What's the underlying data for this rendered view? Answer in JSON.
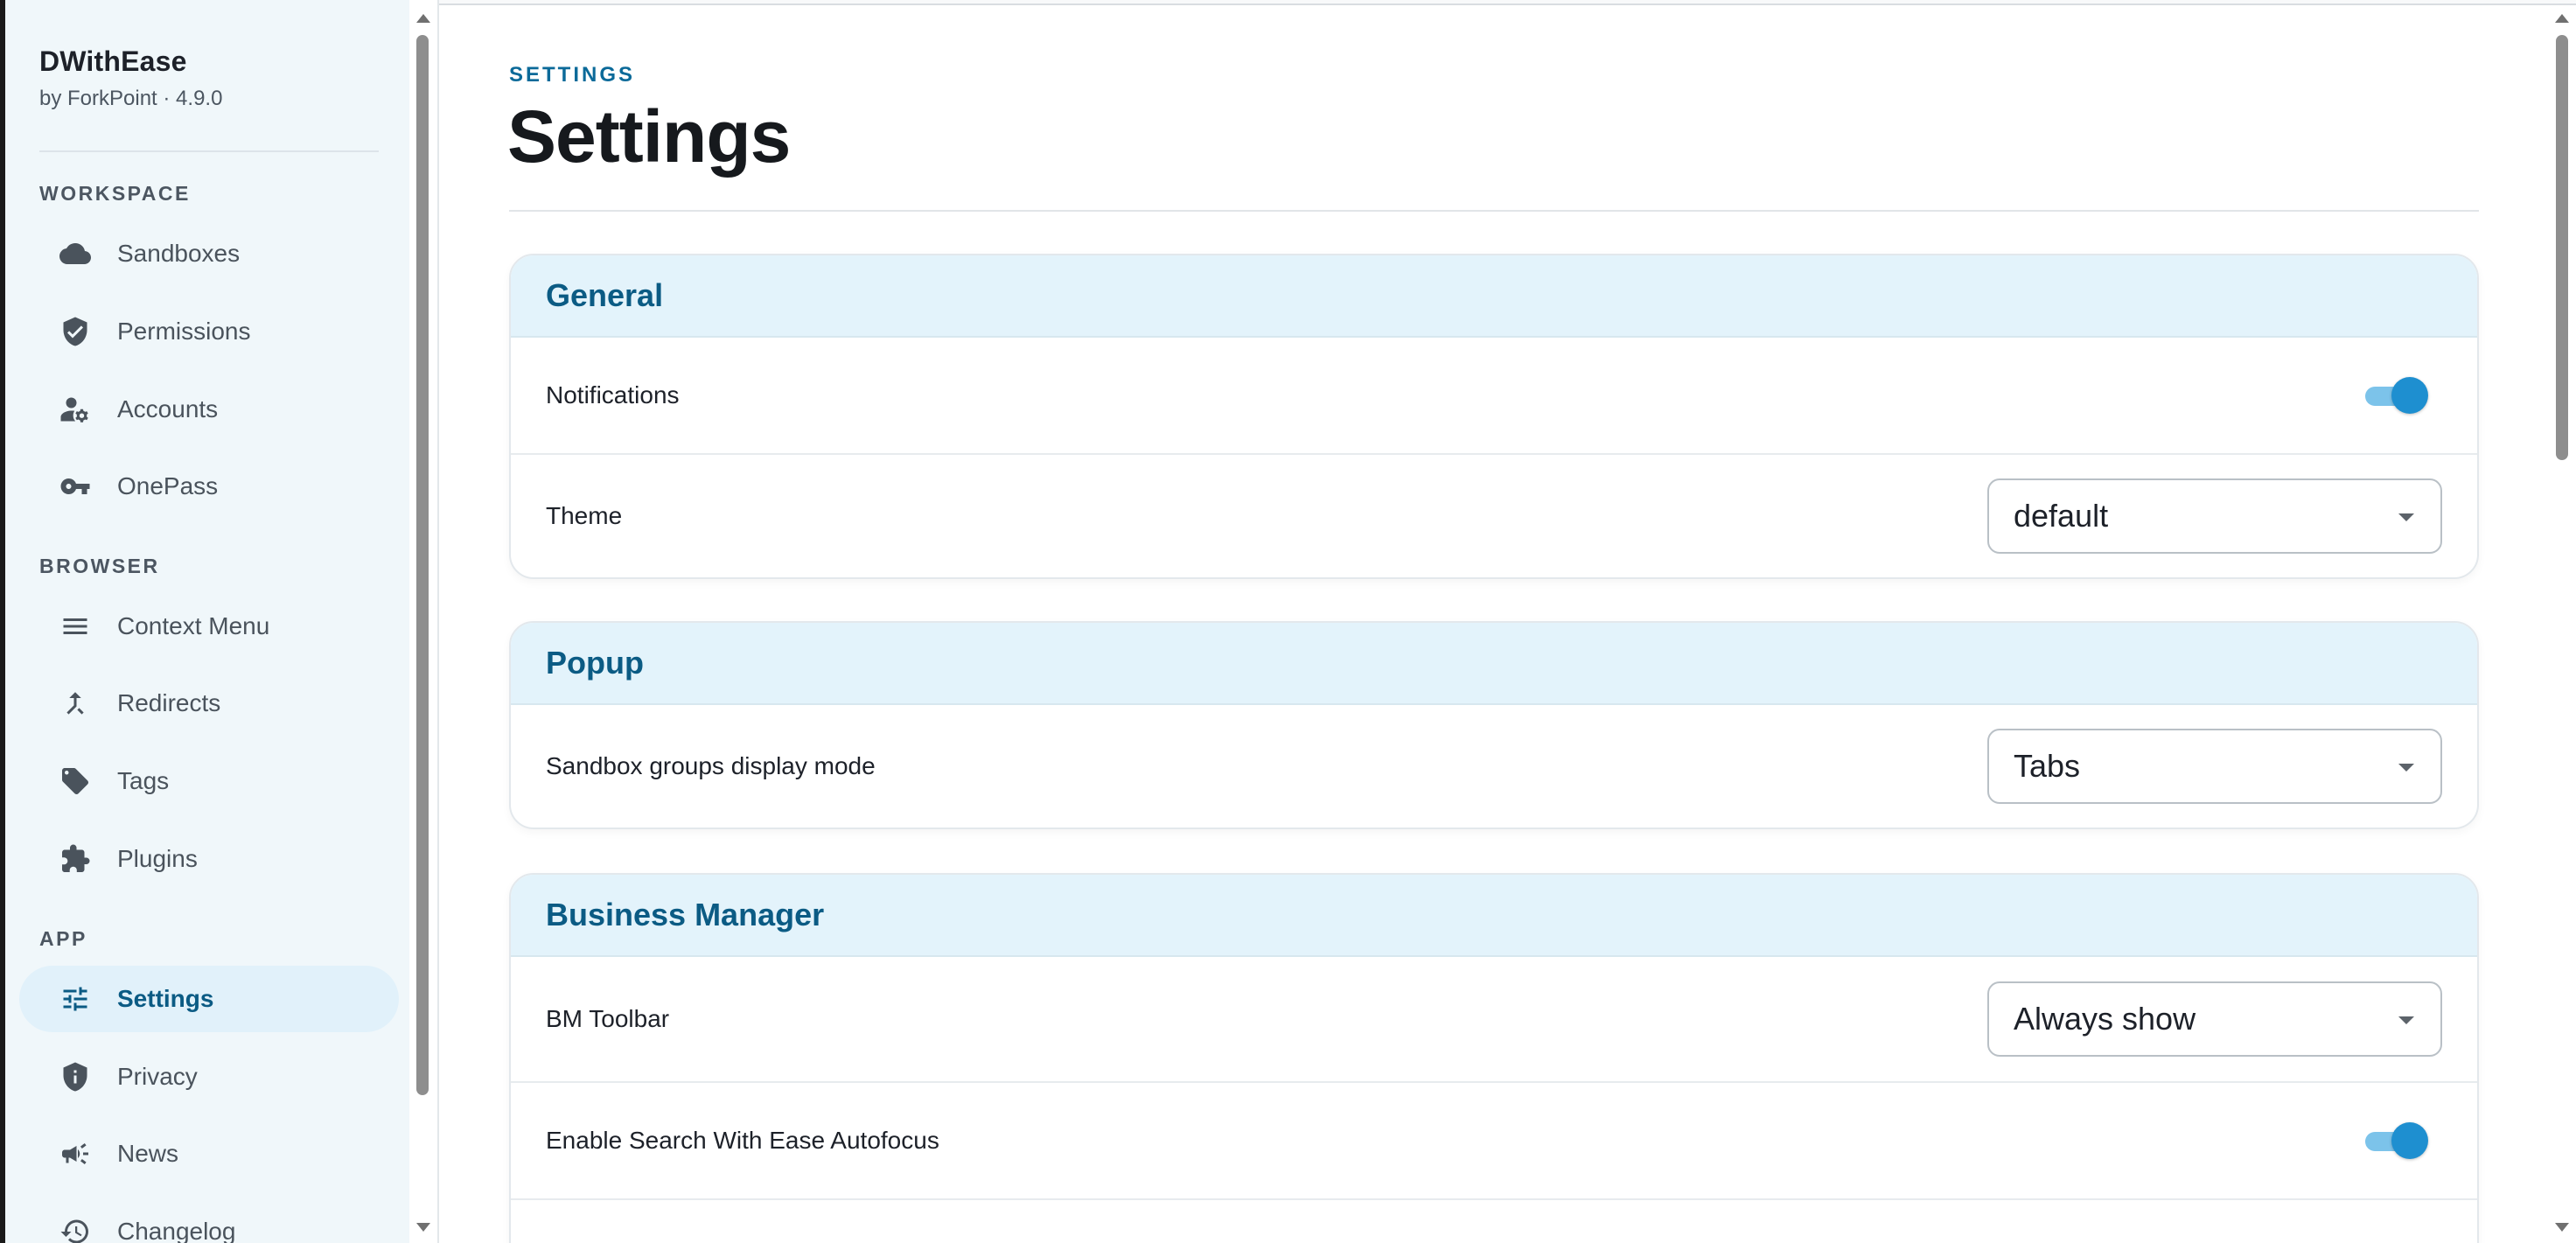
{
  "brand": {
    "name": "DWithEase",
    "subtitle": "by ForkPoint · 4.9.0"
  },
  "sidebar": {
    "sections": [
      {
        "title": "WORKSPACE",
        "items": [
          {
            "label": "Sandboxes",
            "icon": "cloud-icon"
          },
          {
            "label": "Permissions",
            "icon": "shield-check-icon"
          },
          {
            "label": "Accounts",
            "icon": "user-gear-icon"
          },
          {
            "label": "OnePass",
            "icon": "key-icon"
          }
        ]
      },
      {
        "title": "BROWSER",
        "items": [
          {
            "label": "Context Menu",
            "icon": "menu-icon"
          },
          {
            "label": "Redirects",
            "icon": "merge-arrow-icon"
          },
          {
            "label": "Tags",
            "icon": "tag-icon"
          },
          {
            "label": "Plugins",
            "icon": "puzzle-icon"
          }
        ]
      },
      {
        "title": "APP",
        "items": [
          {
            "label": "Settings",
            "icon": "sliders-icon",
            "active": true
          },
          {
            "label": "Privacy",
            "icon": "shield-info-icon"
          },
          {
            "label": "News",
            "icon": "megaphone-icon"
          },
          {
            "label": "Changelog",
            "icon": "history-icon"
          }
        ]
      }
    ]
  },
  "page": {
    "eyebrow": "SETTINGS",
    "title": "Settings"
  },
  "cards": [
    {
      "title": "General",
      "rows": [
        {
          "label": "Notifications",
          "control": "toggle",
          "on": true
        },
        {
          "label": "Theme",
          "control": "select",
          "value": "default"
        }
      ]
    },
    {
      "title": "Popup",
      "rows": [
        {
          "label": "Sandbox groups display mode",
          "control": "select",
          "value": "Tabs"
        }
      ]
    },
    {
      "title": "Business Manager",
      "rows": [
        {
          "label": "BM Toolbar",
          "control": "select",
          "value": "Always show"
        },
        {
          "label": "Enable Search With Ease Autofocus",
          "control": "toggle",
          "on": true
        }
      ]
    }
  ],
  "colors": {
    "accent": "#0b5b84",
    "toggle_on": "#1e8fd0",
    "sidebar_bg": "#f0f7fa",
    "card_header_bg": "#e3f3fb"
  }
}
